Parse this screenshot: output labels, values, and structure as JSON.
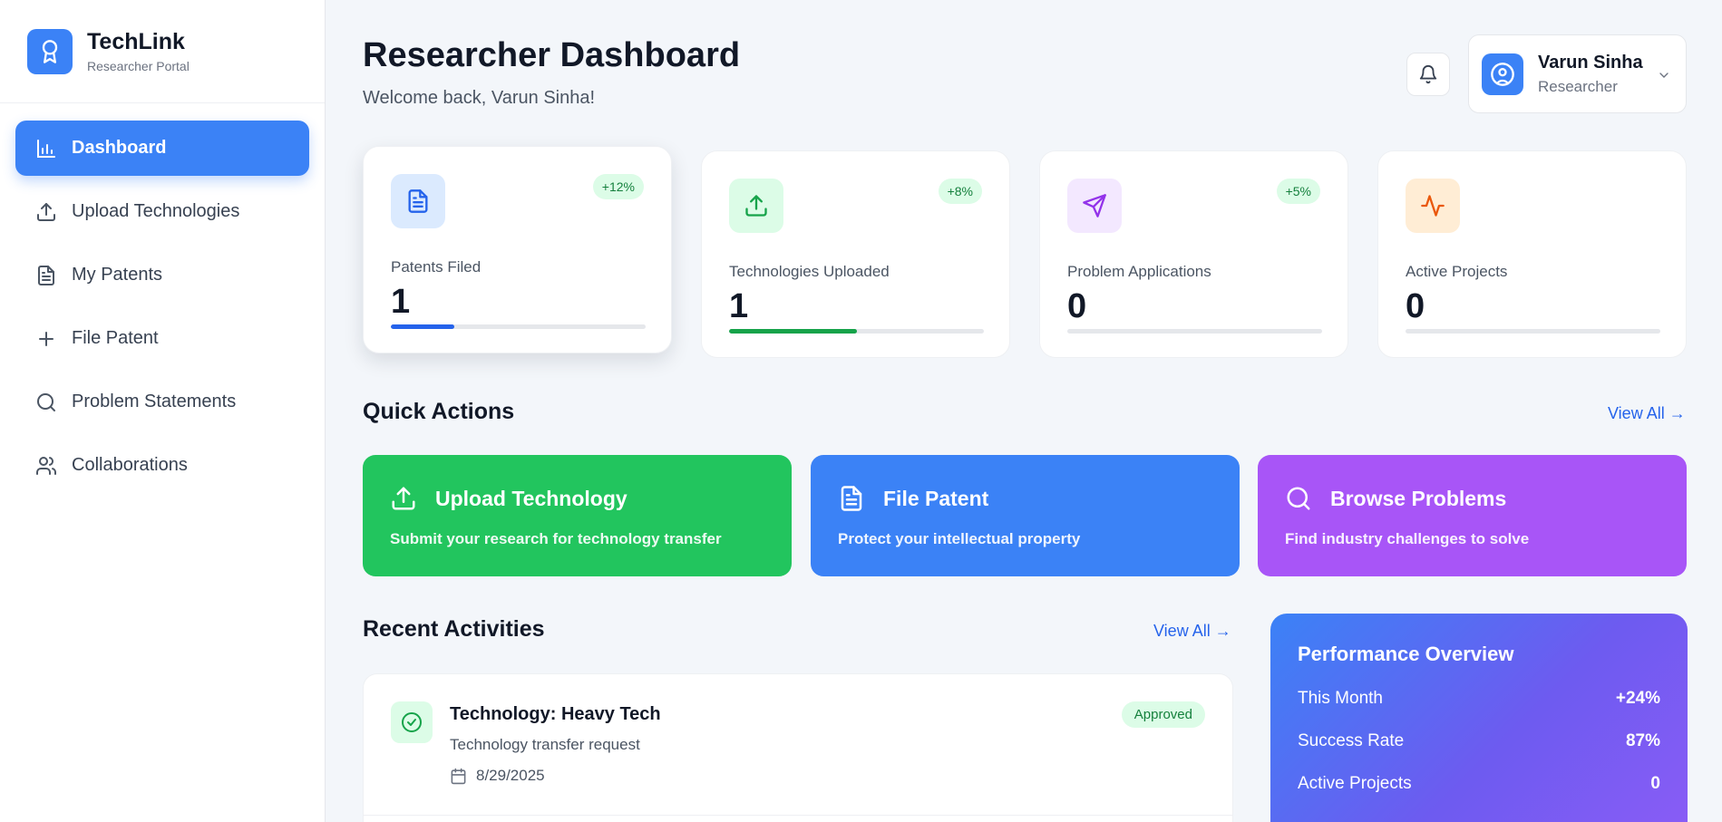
{
  "brand": {
    "name": "TechLink",
    "subtitle": "Researcher Portal"
  },
  "sidebar": {
    "items": [
      {
        "label": "Dashboard",
        "icon": "bar-chart-icon",
        "active": true
      },
      {
        "label": "Upload Technologies",
        "icon": "upload-icon"
      },
      {
        "label": "My Patents",
        "icon": "document-icon"
      },
      {
        "label": "File Patent",
        "icon": "plus-icon"
      },
      {
        "label": "Problem Statements",
        "icon": "search-icon"
      },
      {
        "label": "Collaborations",
        "icon": "users-icon"
      }
    ]
  },
  "header": {
    "title": "Researcher Dashboard",
    "subtitle": "Welcome back, Varun Sinha!",
    "notification_icon": "bell-icon"
  },
  "user": {
    "name": "Varun Sinha",
    "role": "Researcher",
    "icon": "user-circle-icon"
  },
  "stats": [
    {
      "label": "Patents Filed",
      "value": "1",
      "change": "+12%",
      "icon": "document-icon",
      "icon_color": "#2563eb",
      "icon_bg": "#dbeafe",
      "bar_color": "#2563eb",
      "progress_pct": 25
    },
    {
      "label": "Technologies Uploaded",
      "value": "1",
      "change": "+8%",
      "icon": "upload-icon",
      "icon_color": "#16a34a",
      "icon_bg": "#dcfce7",
      "bar_color": "#16a34a",
      "progress_pct": 50
    },
    {
      "label": "Problem Applications",
      "value": "0",
      "change": "+5%",
      "icon": "send-icon",
      "icon_color": "#9333ea",
      "icon_bg": "#f3e8ff",
      "bar_color": "#9333ea",
      "progress_pct": 0
    },
    {
      "label": "Active Projects",
      "value": "0",
      "icon": "activity-icon",
      "icon_color": "#ea580c",
      "icon_bg": "#ffedd5",
      "bar_color": "#ea580c",
      "progress_pct": 0
    }
  ],
  "quick_actions": {
    "title": "Quick Actions",
    "view_all": "View All →",
    "items": [
      {
        "title": "Upload Technology",
        "description": "Submit your research for technology transfer",
        "icon": "upload-icon",
        "color": "#22c55e"
      },
      {
        "title": "File Patent",
        "description": "Protect your intellectual property",
        "icon": "document-icon",
        "color": "#3b82f6"
      },
      {
        "title": "Browse Problems",
        "description": "Find industry challenges to solve",
        "icon": "search-icon",
        "color": "#a855f7"
      }
    ]
  },
  "recent_activities": {
    "title": "Recent Activities",
    "view_all": "View All →",
    "items": [
      {
        "title": "Technology: Heavy Tech",
        "description": "Technology transfer request",
        "date": "8/29/2025",
        "status": "Approved",
        "icon": "check-circle-icon"
      }
    ]
  },
  "performance": {
    "title": "Performance Overview",
    "rows": [
      {
        "label": "This Month",
        "value": "+24%"
      },
      {
        "label": "Success Rate",
        "value": "87%"
      },
      {
        "label": "Active Projects",
        "value": "0"
      }
    ]
  }
}
